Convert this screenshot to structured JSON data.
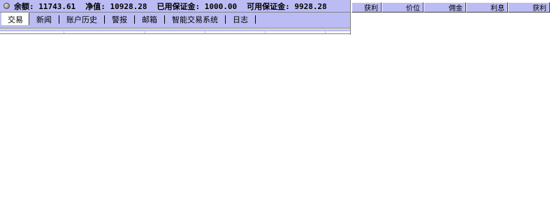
{
  "summary": {
    "balance": "余额: 11743.61",
    "equity": "净值: 10928.28",
    "margin_used": "已用保证金: 1000.00",
    "margin_free": "可用保证金: 9928.28"
  },
  "tabs": [
    {
      "label": "交易",
      "active": true
    },
    {
      "label": "新闻",
      "active": false
    },
    {
      "label": "账户历史",
      "active": false
    },
    {
      "label": "警报",
      "active": false
    },
    {
      "label": "邮箱",
      "active": false
    },
    {
      "label": "智能交易系统",
      "active": false
    },
    {
      "label": "日志",
      "active": false
    }
  ],
  "right_header": {
    "columns": [
      "获利",
      "价位",
      "佣金",
      "利息",
      "获利"
    ]
  },
  "colors": {
    "panel_bg": "#bcbcf4",
    "active_tab_bg": "#ffffff",
    "border_dark": "#808080"
  },
  "icons": {
    "summary": "status-circle-icon"
  }
}
